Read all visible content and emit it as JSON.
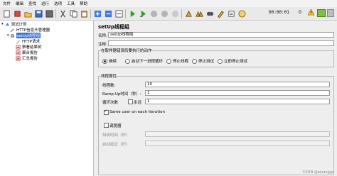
{
  "menu": [
    "文件",
    "编辑",
    "查找",
    "运行",
    "选项",
    "工具",
    "帮助"
  ],
  "status": {
    "timer": "00:00:01",
    "counter": "0"
  },
  "tree": {
    "root": "测试计划",
    "items": [
      {
        "label": "HTTP信息头管理器"
      },
      {
        "label": "setUp线程组",
        "selected": true
      },
      {
        "label": "HTTP请求"
      },
      {
        "label": "察看结果树"
      },
      {
        "label": "聚合报告"
      },
      {
        "label": "汇总报告"
      }
    ]
  },
  "form": {
    "title": "setUp线程组",
    "name_label": "名称:",
    "name_value": "setUp线程组",
    "comment_label": "注释:",
    "comment_value": "",
    "error_group_title": "在取样器错误后要执行的动作",
    "error_actions": [
      {
        "label": "继续",
        "checked": true
      },
      {
        "label": "启动下一进程循环",
        "checked": false
      },
      {
        "label": "停止线程",
        "checked": false
      },
      {
        "label": "停止测试",
        "checked": false
      },
      {
        "label": "立即停止测试",
        "checked": false
      }
    ],
    "thread_group_title": "线程属性",
    "threads_label": "线程数:",
    "threads_value": "10",
    "rampup_label": "Ramp-Up时间（秒）:",
    "rampup_value": "1",
    "loop_label": "循环次数",
    "forever_label": "永远",
    "loop_value": "1",
    "same_user_label": "Same user on each iteration",
    "scheduler_label": "调度器",
    "duration_label": "持续时间（秒）",
    "delay_label": "启动延迟（秒）"
  },
  "watermark": "CSDN @eiuanggx"
}
